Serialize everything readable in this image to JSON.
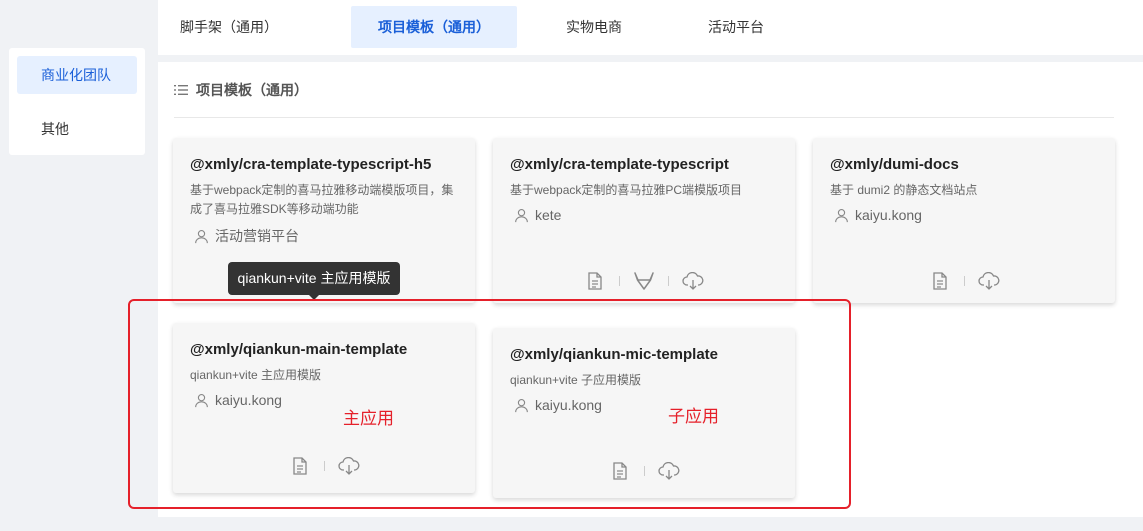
{
  "top_tabs": [
    {
      "label": "脚手架（通用）",
      "active": false
    },
    {
      "label": "项目模板（通用）",
      "active": true
    },
    {
      "label": "实物电商",
      "active": false
    },
    {
      "label": "活动平台",
      "active": false
    }
  ],
  "sidebar": {
    "items": [
      {
        "label": "商业化团队",
        "active": true
      },
      {
        "label": "其他",
        "active": false
      }
    ]
  },
  "section": {
    "title": "项目模板（通用）",
    "icon": "list-icon"
  },
  "cards": [
    {
      "title": "@xmly/cra-template-typescript-h5",
      "description": "基于webpack定制的喜马拉雅移动端模版项目，集成了喜马拉雅SDK等移动端功能",
      "author": "活动营销平台",
      "actions": [
        "document-icon",
        "download-icon"
      ]
    },
    {
      "title": "@xmly/cra-template-typescript",
      "description": "基于webpack定制的喜马拉雅PC端模版项目",
      "author": "kete",
      "actions": [
        "document-icon",
        "gitlab-icon",
        "download-icon"
      ]
    },
    {
      "title": "@xmly/dumi-docs",
      "description": "基于 dumi2 的静态文档站点",
      "author": "kaiyu.kong",
      "actions": [
        "document-icon",
        "download-icon"
      ]
    },
    {
      "title": "@xmly/qiankun-main-template",
      "description": "qiankun+vite 主应用模版",
      "author": "kaiyu.kong",
      "actions": [
        "document-icon",
        "download-icon"
      ]
    },
    {
      "title": "@xmly/qiankun-mic-template",
      "description": "qiankun+vite 子应用模版",
      "author": "kaiyu.kong",
      "actions": [
        "document-icon",
        "download-icon"
      ]
    }
  ],
  "tooltip": {
    "text": "qiankun+vite 主应用模版"
  },
  "annotations": {
    "main_app_label": "主应用",
    "sub_app_label": "子应用",
    "highlight_color": "#e5202a"
  },
  "colors": {
    "accent": "#1a5fd8",
    "accent_bg": "#e6f0ff"
  }
}
